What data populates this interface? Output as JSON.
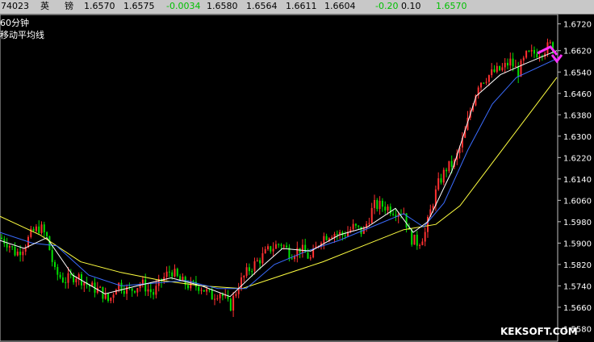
{
  "quote_bar": {
    "code": "74023",
    "name_1": "英",
    "name_2": "镑",
    "prev_close": "1.6570",
    "open": "1.6575",
    "change": "-0.0034",
    "high": "1.6580",
    "low": "1.6564",
    "bid": "1.6611",
    "ask": "1.6604",
    "pct": "-0.20",
    "vol": "0.10",
    "last": "1.6570",
    "colors": {
      "background": "#c8c8c8",
      "text": "#000000",
      "change": "#00c000"
    }
  },
  "chart": {
    "period_label": "60分钟",
    "indicator_label": "移动平均线",
    "watermark": "KEKSOFT.COM",
    "colors": {
      "background": "#000000",
      "frame": "#c0c0c0",
      "up_candle": "#ff3030",
      "down_candle": "#00e000",
      "ma_short": "#ffffff",
      "ma_mid": "#3a6cff",
      "ma_long": "#ffff40",
      "arrow": "#ff30ff"
    }
  },
  "chart_data": {
    "type": "line",
    "ylim": [
      1.553,
      1.6755
    ],
    "y_ticks": [
      "1.6720",
      "1.6620",
      "1.6540",
      "1.6460",
      "1.6380",
      "1.6300",
      "1.6220",
      "1.6140",
      "1.6060",
      "1.5980",
      "1.5900",
      "1.5820",
      "1.5740",
      "1.5660",
      "1.5580"
    ],
    "price_path": [
      [
        0,
        1.592
      ],
      [
        10,
        1.59
      ],
      [
        20,
        1.586
      ],
      [
        30,
        1.589
      ],
      [
        40,
        1.594
      ],
      [
        50,
        1.596
      ],
      [
        58,
        1.592
      ],
      [
        68,
        1.579
      ],
      [
        80,
        1.576
      ],
      [
        95,
        1.578
      ],
      [
        110,
        1.574
      ],
      [
        125,
        1.572
      ],
      [
        135,
        1.568
      ],
      [
        145,
        1.575
      ],
      [
        160,
        1.572
      ],
      [
        175,
        1.575
      ],
      [
        190,
        1.571
      ],
      [
        200,
        1.576
      ],
      [
        212,
        1.58
      ],
      [
        222,
        1.576
      ],
      [
        235,
        1.574
      ],
      [
        248,
        1.574
      ],
      [
        262,
        1.57
      ],
      [
        272,
        1.572
      ],
      [
        285,
        1.566
      ],
      [
        295,
        1.574
      ],
      [
        308,
        1.58
      ],
      [
        322,
        1.584
      ],
      [
        335,
        1.588
      ],
      [
        348,
        1.59
      ],
      [
        360,
        1.586
      ],
      [
        372,
        1.588
      ],
      [
        385,
        1.584
      ],
      [
        398,
        1.592
      ],
      [
        412,
        1.594
      ],
      [
        425,
        1.593
      ],
      [
        438,
        1.596
      ],
      [
        450,
        1.594
      ],
      [
        463,
        1.604
      ],
      [
        475,
        1.604
      ],
      [
        490,
        1.602
      ],
      [
        500,
        1.602
      ],
      [
        508,
        1.592
      ],
      [
        518,
        1.59
      ],
      [
        527,
        1.594
      ],
      [
        535,
        1.604
      ],
      [
        543,
        1.612
      ],
      [
        553,
        1.618
      ],
      [
        563,
        1.62
      ],
      [
        575,
        1.63
      ],
      [
        583,
        1.64
      ],
      [
        593,
        1.65
      ],
      [
        602,
        1.652
      ],
      [
        612,
        1.654
      ],
      [
        622,
        1.655
      ],
      [
        632,
        1.658
      ],
      [
        642,
        1.654
      ],
      [
        652,
        1.66
      ],
      [
        662,
        1.661
      ],
      [
        672,
        1.662
      ],
      [
        682,
        1.664
      ],
      [
        690,
        1.661
      ]
    ],
    "ma_short": [
      [
        0,
        1.591
      ],
      [
        30,
        1.588
      ],
      [
        58,
        1.592
      ],
      [
        90,
        1.578
      ],
      [
        130,
        1.571
      ],
      [
        170,
        1.574
      ],
      [
        212,
        1.577
      ],
      [
        250,
        1.574
      ],
      [
        285,
        1.57
      ],
      [
        320,
        1.58
      ],
      [
        350,
        1.588
      ],
      [
        385,
        1.587
      ],
      [
        420,
        1.593
      ],
      [
        455,
        1.596
      ],
      [
        490,
        1.603
      ],
      [
        512,
        1.594
      ],
      [
        530,
        1.598
      ],
      [
        560,
        1.617
      ],
      [
        590,
        1.645
      ],
      [
        620,
        1.653
      ],
      [
        650,
        1.657
      ],
      [
        690,
        1.662
      ]
    ],
    "ma_mid": [
      [
        0,
        1.594
      ],
      [
        40,
        1.59
      ],
      [
        70,
        1.589
      ],
      [
        110,
        1.578
      ],
      [
        150,
        1.574
      ],
      [
        190,
        1.575
      ],
      [
        230,
        1.576
      ],
      [
        270,
        1.573
      ],
      [
        305,
        1.573
      ],
      [
        340,
        1.582
      ],
      [
        380,
        1.587
      ],
      [
        420,
        1.591
      ],
      [
        460,
        1.596
      ],
      [
        500,
        1.601
      ],
      [
        525,
        1.596
      ],
      [
        550,
        1.605
      ],
      [
        580,
        1.625
      ],
      [
        610,
        1.642
      ],
      [
        640,
        1.652
      ],
      [
        690,
        1.659
      ]
    ],
    "ma_long": [
      [
        0,
        1.6
      ],
      [
        50,
        1.593
      ],
      [
        100,
        1.583
      ],
      [
        150,
        1.579
      ],
      [
        200,
        1.576
      ],
      [
        250,
        1.574
      ],
      [
        300,
        1.573
      ],
      [
        350,
        1.578
      ],
      [
        400,
        1.583
      ],
      [
        450,
        1.589
      ],
      [
        500,
        1.595
      ],
      [
        540,
        1.597
      ],
      [
        570,
        1.604
      ],
      [
        600,
        1.616
      ],
      [
        630,
        1.628
      ],
      [
        660,
        1.64
      ],
      [
        690,
        1.652
      ]
    ]
  }
}
